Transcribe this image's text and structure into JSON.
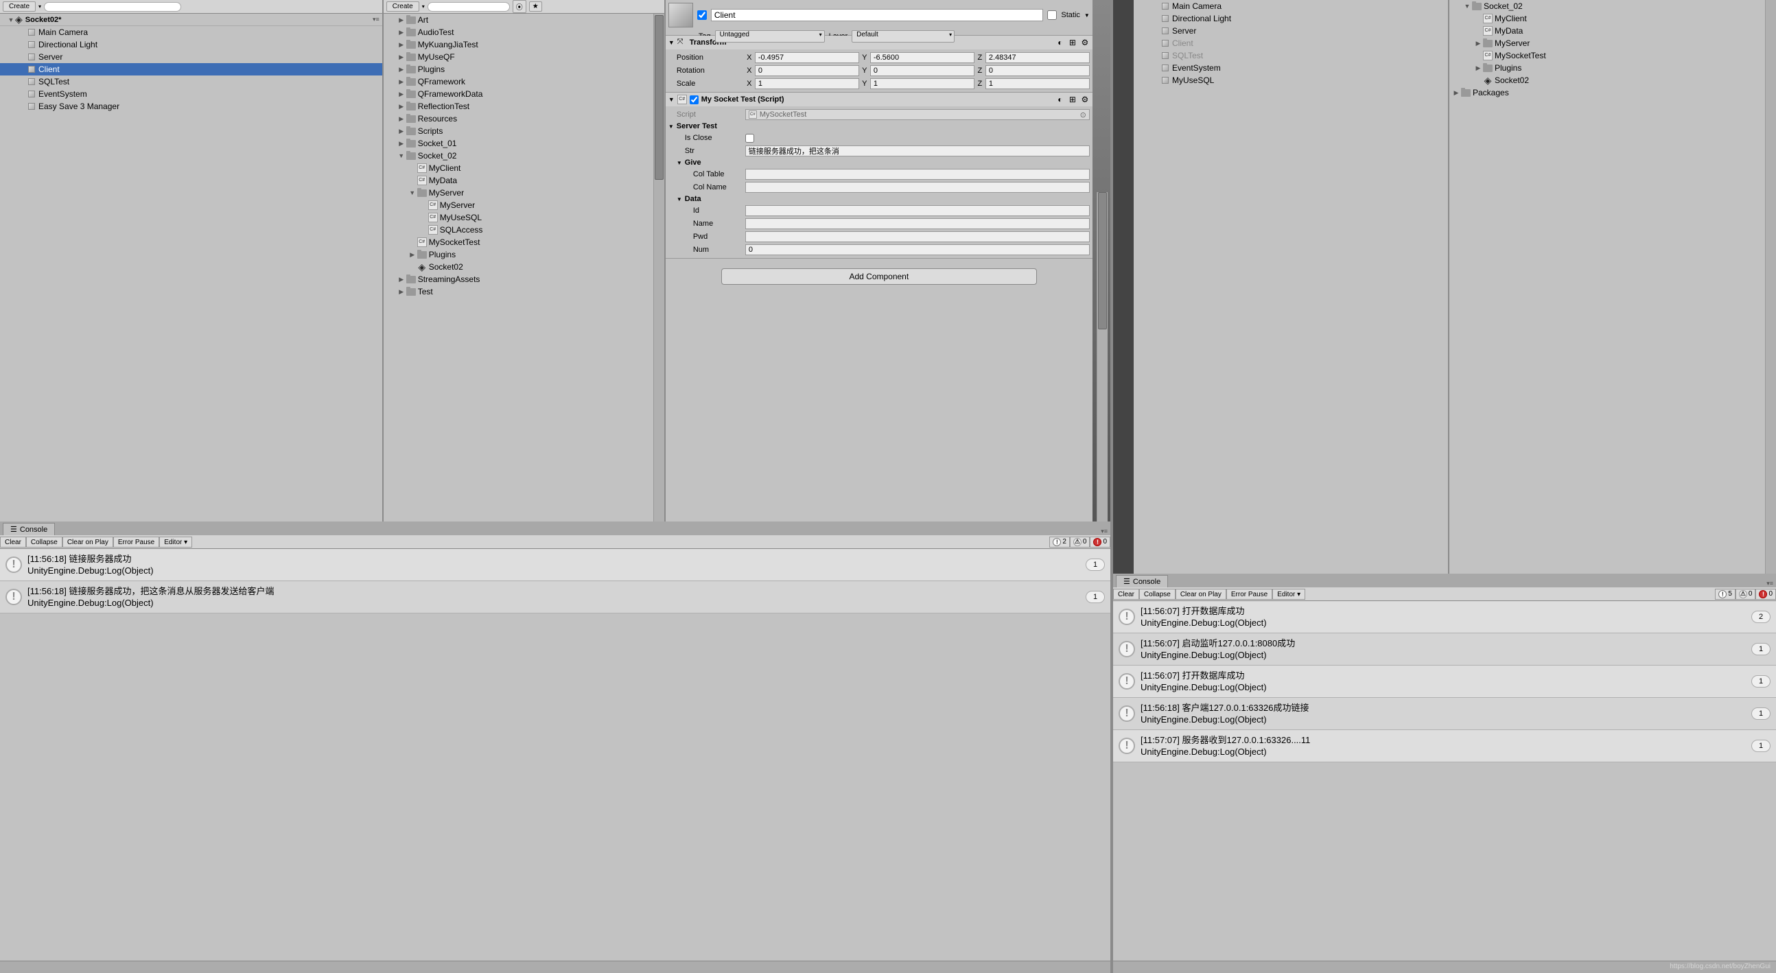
{
  "left": {
    "hierarchy": {
      "create_btn": "Create",
      "scene_name": "Socket02*",
      "items": [
        {
          "label": "Main Camera",
          "indent": 1
        },
        {
          "label": "Directional Light",
          "indent": 1
        },
        {
          "label": "Server",
          "indent": 1
        },
        {
          "label": "Client",
          "indent": 1,
          "selected": true
        },
        {
          "label": "SQLTest",
          "indent": 1
        },
        {
          "label": "EventSystem",
          "indent": 1
        },
        {
          "label": "Easy Save 3 Manager",
          "indent": 1
        }
      ]
    },
    "project": {
      "create_btn": "Create",
      "items": [
        {
          "arrow": "right",
          "icon": "folder",
          "label": "Art",
          "indent": 0
        },
        {
          "arrow": "right",
          "icon": "folder",
          "label": "AudioTest",
          "indent": 0
        },
        {
          "arrow": "right",
          "icon": "folder",
          "label": "MyKuangJiaTest",
          "indent": 0
        },
        {
          "arrow": "right",
          "icon": "folder",
          "label": "MyUseQF",
          "indent": 0
        },
        {
          "arrow": "right",
          "icon": "folder",
          "label": "Plugins",
          "indent": 0
        },
        {
          "arrow": "right",
          "icon": "folder",
          "label": "QFramework",
          "indent": 0
        },
        {
          "arrow": "right",
          "icon": "folder",
          "label": "QFrameworkData",
          "indent": 0
        },
        {
          "arrow": "right",
          "icon": "folder",
          "label": "ReflectionTest",
          "indent": 0
        },
        {
          "arrow": "right",
          "icon": "folder",
          "label": "Resources",
          "indent": 0
        },
        {
          "arrow": "right",
          "icon": "folder",
          "label": "Scripts",
          "indent": 0
        },
        {
          "arrow": "right",
          "icon": "folder",
          "label": "Socket_01",
          "indent": 0
        },
        {
          "arrow": "down",
          "icon": "folder",
          "label": "Socket_02",
          "indent": 0
        },
        {
          "arrow": "none",
          "icon": "cs",
          "label": "MyClient",
          "indent": 1
        },
        {
          "arrow": "none",
          "icon": "cs",
          "label": "MyData",
          "indent": 1
        },
        {
          "arrow": "down",
          "icon": "folder",
          "label": "MyServer",
          "indent": 1
        },
        {
          "arrow": "none",
          "icon": "cs",
          "label": "MyServer",
          "indent": 2
        },
        {
          "arrow": "none",
          "icon": "cs",
          "label": "MyUseSQL",
          "indent": 2
        },
        {
          "arrow": "none",
          "icon": "cs",
          "label": "SQLAccess",
          "indent": 2
        },
        {
          "arrow": "none",
          "icon": "cs",
          "label": "MySocketTest",
          "indent": 1
        },
        {
          "arrow": "right",
          "icon": "folder",
          "label": "Plugins",
          "indent": 1
        },
        {
          "arrow": "none",
          "icon": "unity",
          "label": "Socket02",
          "indent": 1
        },
        {
          "arrow": "right",
          "icon": "folder",
          "label": "StreamingAssets",
          "indent": 0
        },
        {
          "arrow": "right",
          "icon": "folder",
          "label": "Test",
          "indent": 0
        }
      ]
    },
    "inspector": {
      "name": "Client",
      "static_label": "Static",
      "tag_label": "Tag",
      "tag_value": "Untagged",
      "layer_label": "Layer",
      "layer_value": "Default",
      "transform": {
        "title": "Transform",
        "position_label": "Position",
        "rotation_label": "Rotation",
        "scale_label": "Scale",
        "pos": {
          "x": "-0.4957",
          "y": "-6.5600",
          "z": "2.48347"
        },
        "rot": {
          "x": "0",
          "y": "0",
          "z": "0"
        },
        "scale": {
          "x": "1",
          "y": "1",
          "z": "1"
        }
      },
      "script_comp": {
        "title": "My Socket Test (Script)",
        "script_label": "Script",
        "script_value": "MySocketTest",
        "server_test_label": "Server Test",
        "is_close_label": "Is Close",
        "str_label": "Str",
        "str_value": "链接服务器成功，把这条消",
        "give_label": "Give",
        "col_table_label": "Col Table",
        "col_name_label": "Col Name",
        "data_label": "Data",
        "id_label": "Id",
        "name_label": "Name",
        "pwd_label": "Pwd",
        "num_label": "Num",
        "num_value": "0"
      },
      "add_component": "Add Component"
    },
    "console": {
      "tab": "Console",
      "clear": "Clear",
      "collapse": "Collapse",
      "clear_on_play": "Clear on Play",
      "error_pause": "Error Pause",
      "editor": "Editor",
      "count_info": "2",
      "count_warn": "0",
      "count_err": "0",
      "logs": [
        {
          "line1": "[11:56:18] 链接服务器成功",
          "line2": "UnityEngine.Debug:Log(Object)",
          "count": "1"
        },
        {
          "line1": "[11:56:18] 链接服务器成功，把这条消息从服务器发送给客户端",
          "line2": "UnityEngine.Debug:Log(Object)",
          "count": "1"
        }
      ]
    }
  },
  "right": {
    "hierarchy": {
      "items": [
        {
          "label": "Main Camera",
          "indent": 1
        },
        {
          "label": "Directional Light",
          "indent": 1
        },
        {
          "label": "Server",
          "indent": 1
        },
        {
          "label": "Client",
          "indent": 1,
          "dim": true
        },
        {
          "label": "SQLTest",
          "indent": 1,
          "dim": true
        },
        {
          "label": "EventSystem",
          "indent": 1
        },
        {
          "label": "MyUseSQL",
          "indent": 1
        }
      ]
    },
    "project": {
      "items": [
        {
          "arrow": "down",
          "icon": "folder",
          "label": "Socket_02",
          "indent": 0
        },
        {
          "arrow": "none",
          "icon": "cs",
          "label": "MyClient",
          "indent": 1
        },
        {
          "arrow": "none",
          "icon": "cs",
          "label": "MyData",
          "indent": 1
        },
        {
          "arrow": "right",
          "icon": "folder",
          "label": "MyServer",
          "indent": 1
        },
        {
          "arrow": "none",
          "icon": "cs",
          "label": "MySocketTest",
          "indent": 1
        },
        {
          "arrow": "right",
          "icon": "folder",
          "label": "Plugins",
          "indent": 1
        },
        {
          "arrow": "none",
          "icon": "unity",
          "label": "Socket02",
          "indent": 1
        },
        {
          "arrow": "right",
          "icon": "folder",
          "label": "Packages",
          "indent": -1
        }
      ]
    },
    "console": {
      "tab": "Console",
      "clear": "Clear",
      "collapse": "Collapse",
      "clear_on_play": "Clear on Play",
      "error_pause": "Error Pause",
      "editor": "Editor",
      "count_info": "5",
      "count_warn": "0",
      "count_err": "0",
      "logs": [
        {
          "line1": "[11:56:07] 打开数据库成功",
          "line2": "UnityEngine.Debug:Log(Object)",
          "count": "2"
        },
        {
          "line1": "[11:56:07] 启动监听127.0.0.1:8080成功",
          "line2": "UnityEngine.Debug:Log(Object)",
          "count": "1"
        },
        {
          "line1": "[11:56:07] 打开数据库成功",
          "line2": "UnityEngine.Debug:Log(Object)",
          "count": "1"
        },
        {
          "line1": "[11:56:18] 客户端127.0.0.1:63326成功链接",
          "line2": "UnityEngine.Debug:Log(Object)",
          "count": "1"
        },
        {
          "line1": "[11:57:07] 服务器收到127.0.0.1:63326....11",
          "line2": "UnityEngine.Debug:Log(Object)",
          "count": "1"
        }
      ]
    }
  },
  "watermark": "https://blog.csdn.net/boyZhenGui"
}
